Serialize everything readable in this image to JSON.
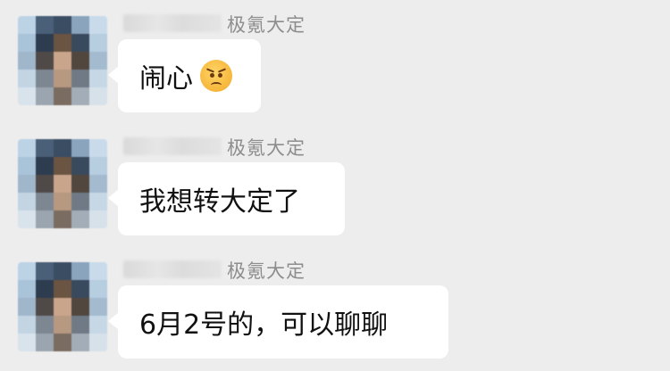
{
  "messages": [
    {
      "group_tag": "极氪大定",
      "text": "闹心",
      "emoji": "angry-face-icon"
    },
    {
      "group_tag": "极氪大定",
      "text": "我想转大定了"
    },
    {
      "group_tag": "极氪大定",
      "text": "6月2号的，可以聊聊"
    }
  ],
  "colors": {
    "background": "#ededed",
    "bubble": "#ffffff",
    "text": "#111111",
    "tag": "#8d8d8d"
  }
}
